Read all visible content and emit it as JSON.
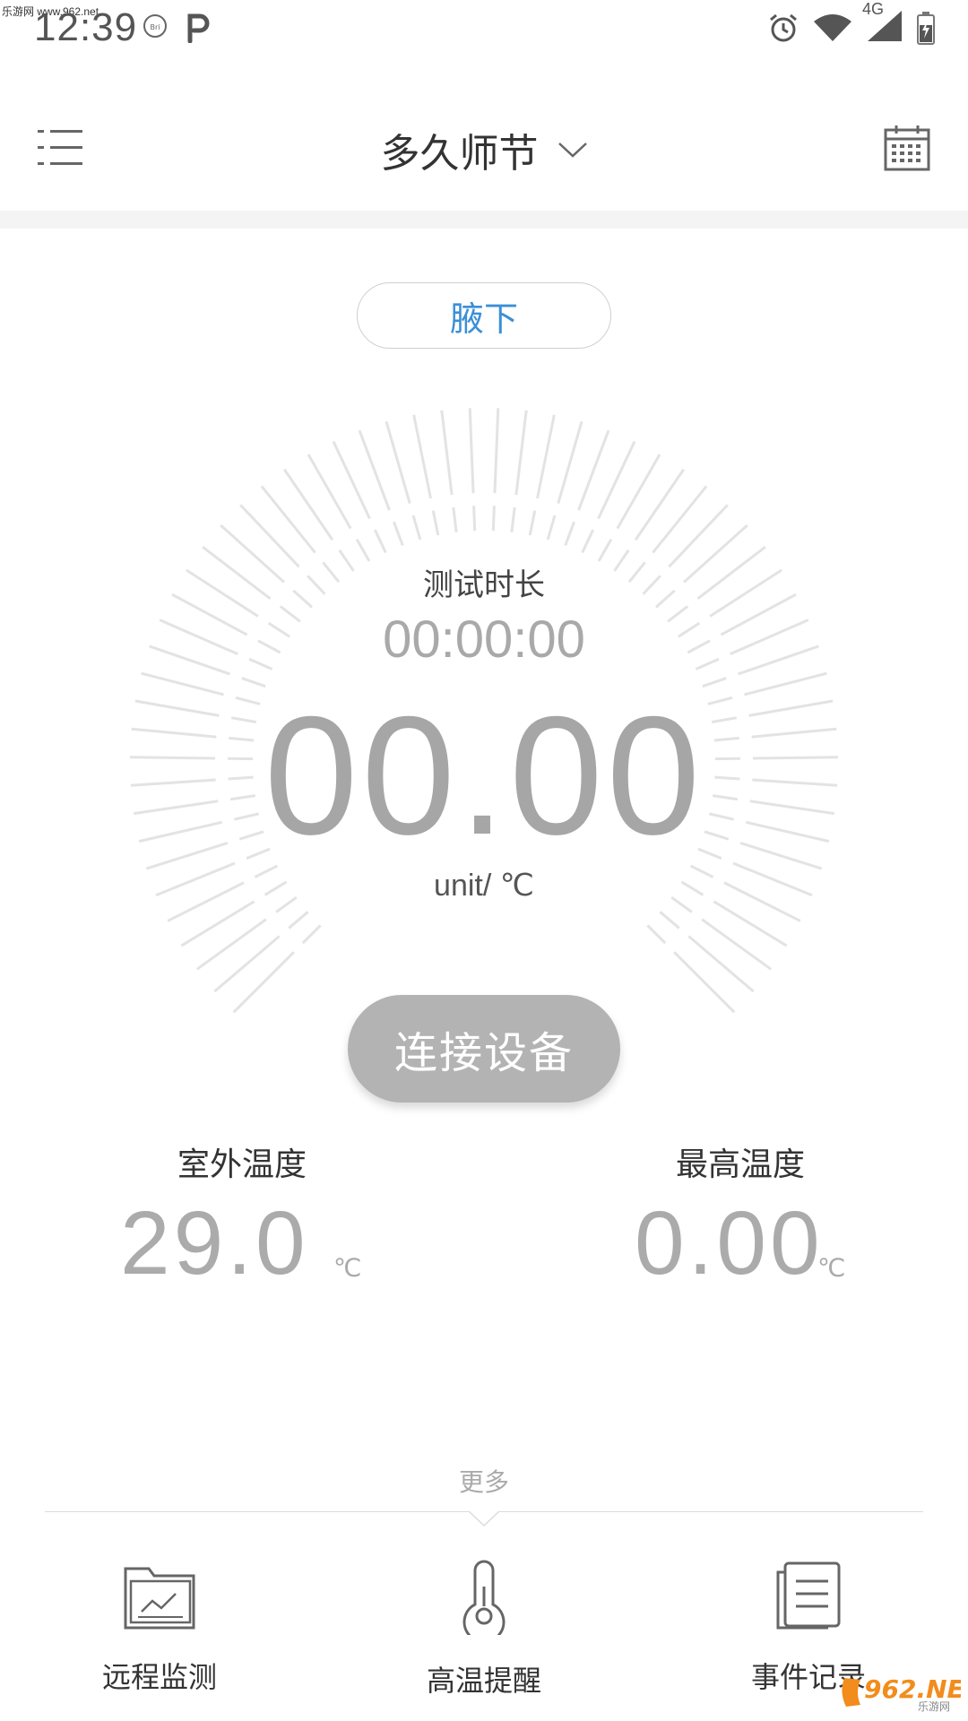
{
  "status_bar": {
    "watermark": "乐游网 www.962.net",
    "time": "12:39",
    "network": "4G"
  },
  "header": {
    "title": "多久师节",
    "menu_icon": "list-menu-icon",
    "calendar_icon": "calendar-icon"
  },
  "location": {
    "label": "腋下"
  },
  "measurement": {
    "duration_label": "测试时长",
    "duration_value": "00:00:00",
    "temperature": "00.00",
    "unit": "unit/ ℃"
  },
  "connect_button": {
    "label": "连接设备"
  },
  "stats": {
    "outdoor": {
      "label": "室外温度",
      "value": "29.0",
      "unit": "℃"
    },
    "max": {
      "label": "最高温度",
      "value": "0.00",
      "unit": "℃"
    }
  },
  "more": {
    "label": "更多"
  },
  "bottom_nav": [
    {
      "label": "远程监测",
      "icon": "chart-folder-icon"
    },
    {
      "label": "高温提醒",
      "icon": "thermometer-icon"
    },
    {
      "label": "事件记录",
      "icon": "document-list-icon"
    }
  ],
  "corner_watermark": {
    "text": "962.NET",
    "subtext": "乐游网"
  },
  "colors": {
    "accent": "#3b8fd6",
    "button_gray": "#b3b3b3",
    "value_gray": "#a6a6a6"
  }
}
